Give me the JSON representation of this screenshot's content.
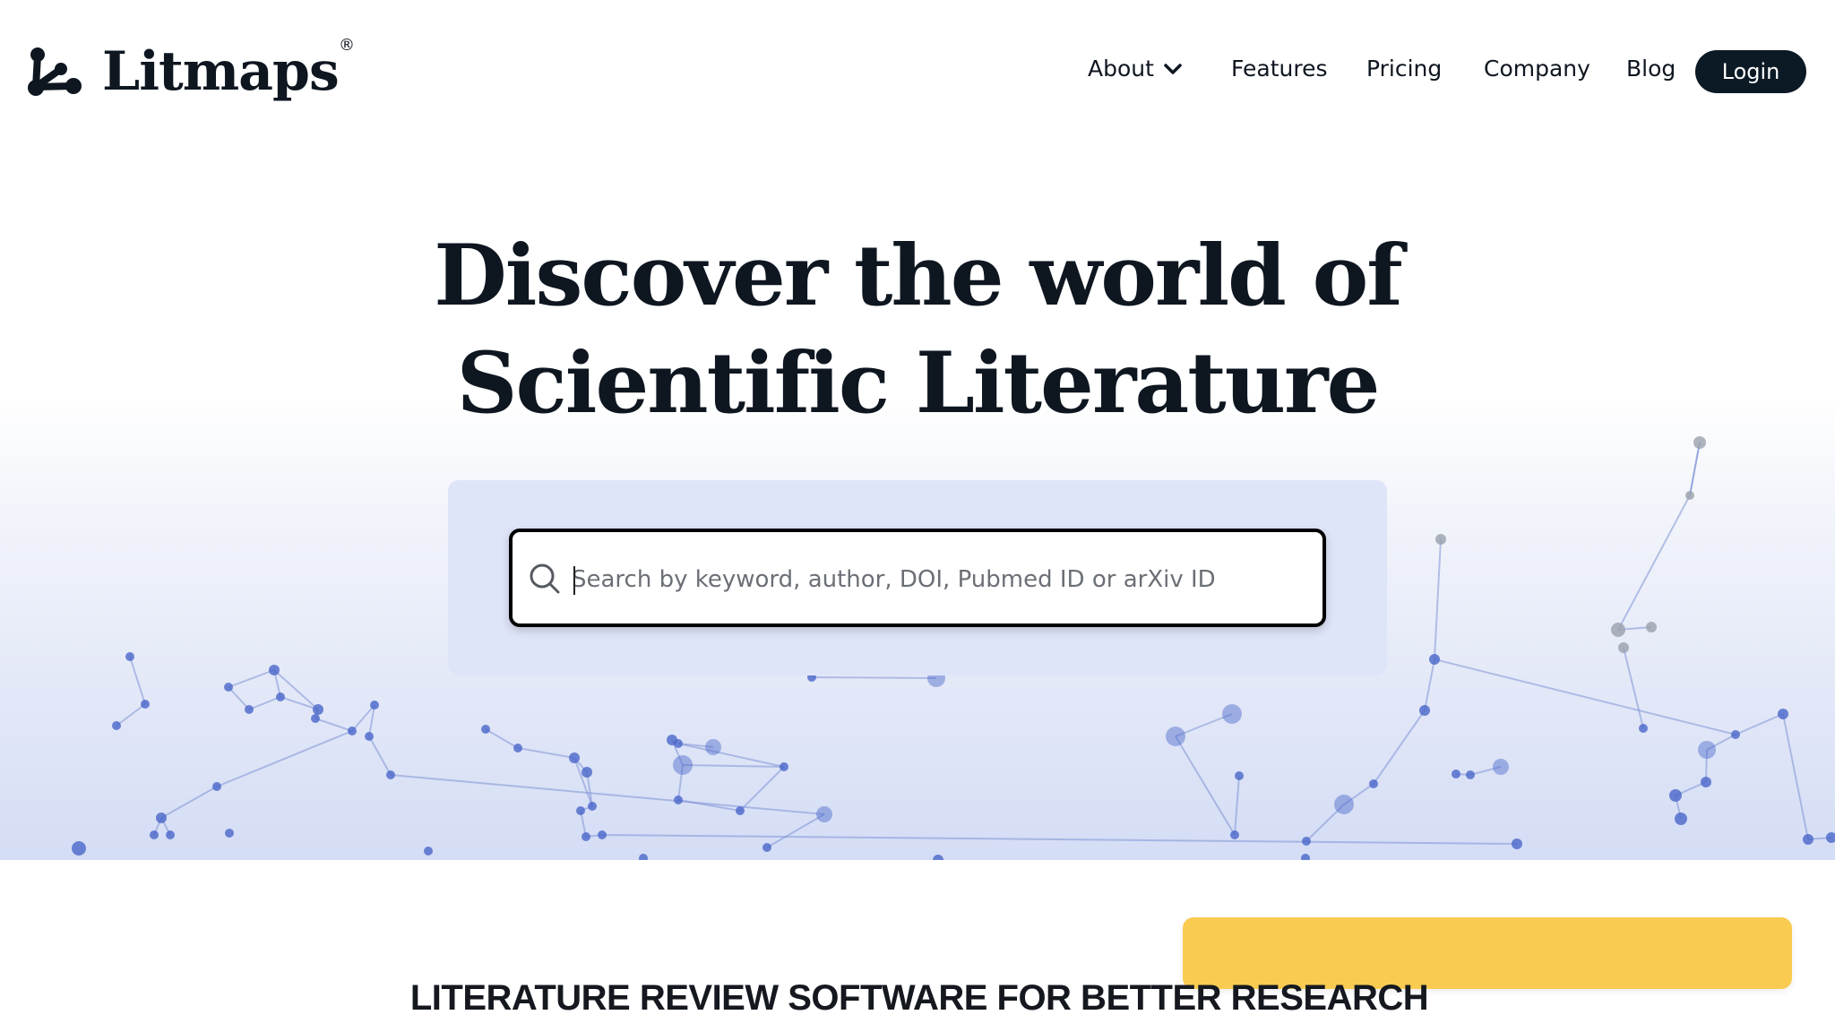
{
  "brand": {
    "name": "Litmaps",
    "registered": "®"
  },
  "nav": {
    "items": [
      "About",
      "Features",
      "Pricing",
      "Company",
      "Blog"
    ],
    "login": "Login"
  },
  "hero": {
    "headline_line1": "Discover the world of",
    "headline_line2": "Scientific Literature",
    "search_placeholder": "Search by keyword, author, DOI, Pubmed ID or arXiv ID"
  },
  "section": {
    "tagline": "LITERATURE REVIEW SOFTWARE FOR BETTER RESEARCH"
  },
  "colors": {
    "text": "#0e1620",
    "login_bg": "#0c1a26",
    "search_panel": "#dfe5f9",
    "network_node": "#4a67c9",
    "notice_bar": "#f9c94a"
  }
}
